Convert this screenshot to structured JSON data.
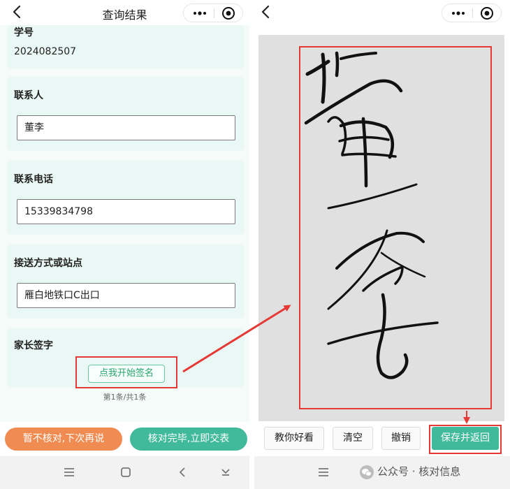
{
  "left": {
    "title": "查询结果",
    "fields": [
      {
        "label": "学号",
        "value": "2024082507"
      },
      {
        "label": "联系人",
        "value": "董李"
      },
      {
        "label": "联系电话",
        "value": "15339834798"
      },
      {
        "label": "接送方式或站点",
        "value": "雁白地铁口C出口"
      }
    ],
    "signature_label": "家长签字",
    "sign_button": "点我开始签名",
    "pagination": "第1条/共1条",
    "later_button": "暂不核对,下次再说",
    "submit_button": "核对完毕,立即交表"
  },
  "right": {
    "toolbar": {
      "beautify": "教你好看",
      "clear": "清空",
      "undo": "撤销",
      "save": "保存并返回"
    },
    "watermark": "公众号 · 核对信息"
  },
  "colors": {
    "accent_teal": "#41ba9c",
    "accent_orange": "#f08b51",
    "highlight_red": "#e53935",
    "card_bg": "#eaf8f5"
  }
}
